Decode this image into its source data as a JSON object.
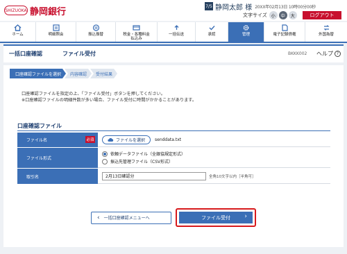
{
  "brand": {
    "logo_mark": "SHIZUOKA",
    "name": "静岡銀行",
    "color": "#c8102e"
  },
  "user": {
    "badge": "7/5",
    "name": "静岡太郎 様",
    "timestamp": "20XX年02月13日 10時00分00秒"
  },
  "font_size": {
    "label": "文字サイズ",
    "options": [
      "小",
      "中",
      "大"
    ],
    "selected": "中"
  },
  "logout_label": "ログアウト",
  "nav": {
    "items": [
      {
        "label": "ホーム",
        "icon": "home-icon"
      },
      {
        "label": "明細照会",
        "icon": "list-icon"
      },
      {
        "label": "振込振替",
        "icon": "transfer-icon"
      },
      {
        "label": "税金・各種料金\n払込み",
        "icon": "payment-icon"
      },
      {
        "label": "一括伝送",
        "icon": "upload-icon"
      },
      {
        "label": "承認",
        "icon": "approval-icon"
      },
      {
        "label": "管理",
        "icon": "gear-icon"
      },
      {
        "label": "電子記録債権",
        "icon": "document-icon"
      },
      {
        "label": "外国為替",
        "icon": "forex-icon"
      }
    ],
    "active_index": 6
  },
  "page": {
    "title": "一括口座確認",
    "subtitle": "ファイル受付",
    "screen_id": "BKKK002",
    "help_label": "ヘルプ"
  },
  "steps": [
    "口座確認ファイルを選択",
    "内容確認",
    "受付結果"
  ],
  "note": {
    "line1": "口座確認ファイルを指定の上、「ファイル受付」ボタンを押してください。",
    "line2": "※口座確認ファイルの明細件数が多い場合、ファイル受付に時間がかかることがあります。"
  },
  "section_title": "口座確認ファイル",
  "form": {
    "file_name_label": "ファイル名",
    "required_label": "必須",
    "file_select_label": "ファイルを選択",
    "file_value": "senddata.txt",
    "file_format_label": "ファイル形式",
    "format_options": [
      "依頼データファイル（全銀協規定形式）",
      "振込先管理ファイル（CSV形式）"
    ],
    "format_selected": 0,
    "remarks_label": "取引名",
    "remarks_value": "2月13日確認分",
    "remarks_hint": "全角10文字以内［半角可］"
  },
  "buttons": {
    "back": "一括口座確認メニューへ",
    "submit": "ファイル受付"
  },
  "colors": {
    "accent": "#3b6fb6",
    "highlight": "#d7191c"
  }
}
